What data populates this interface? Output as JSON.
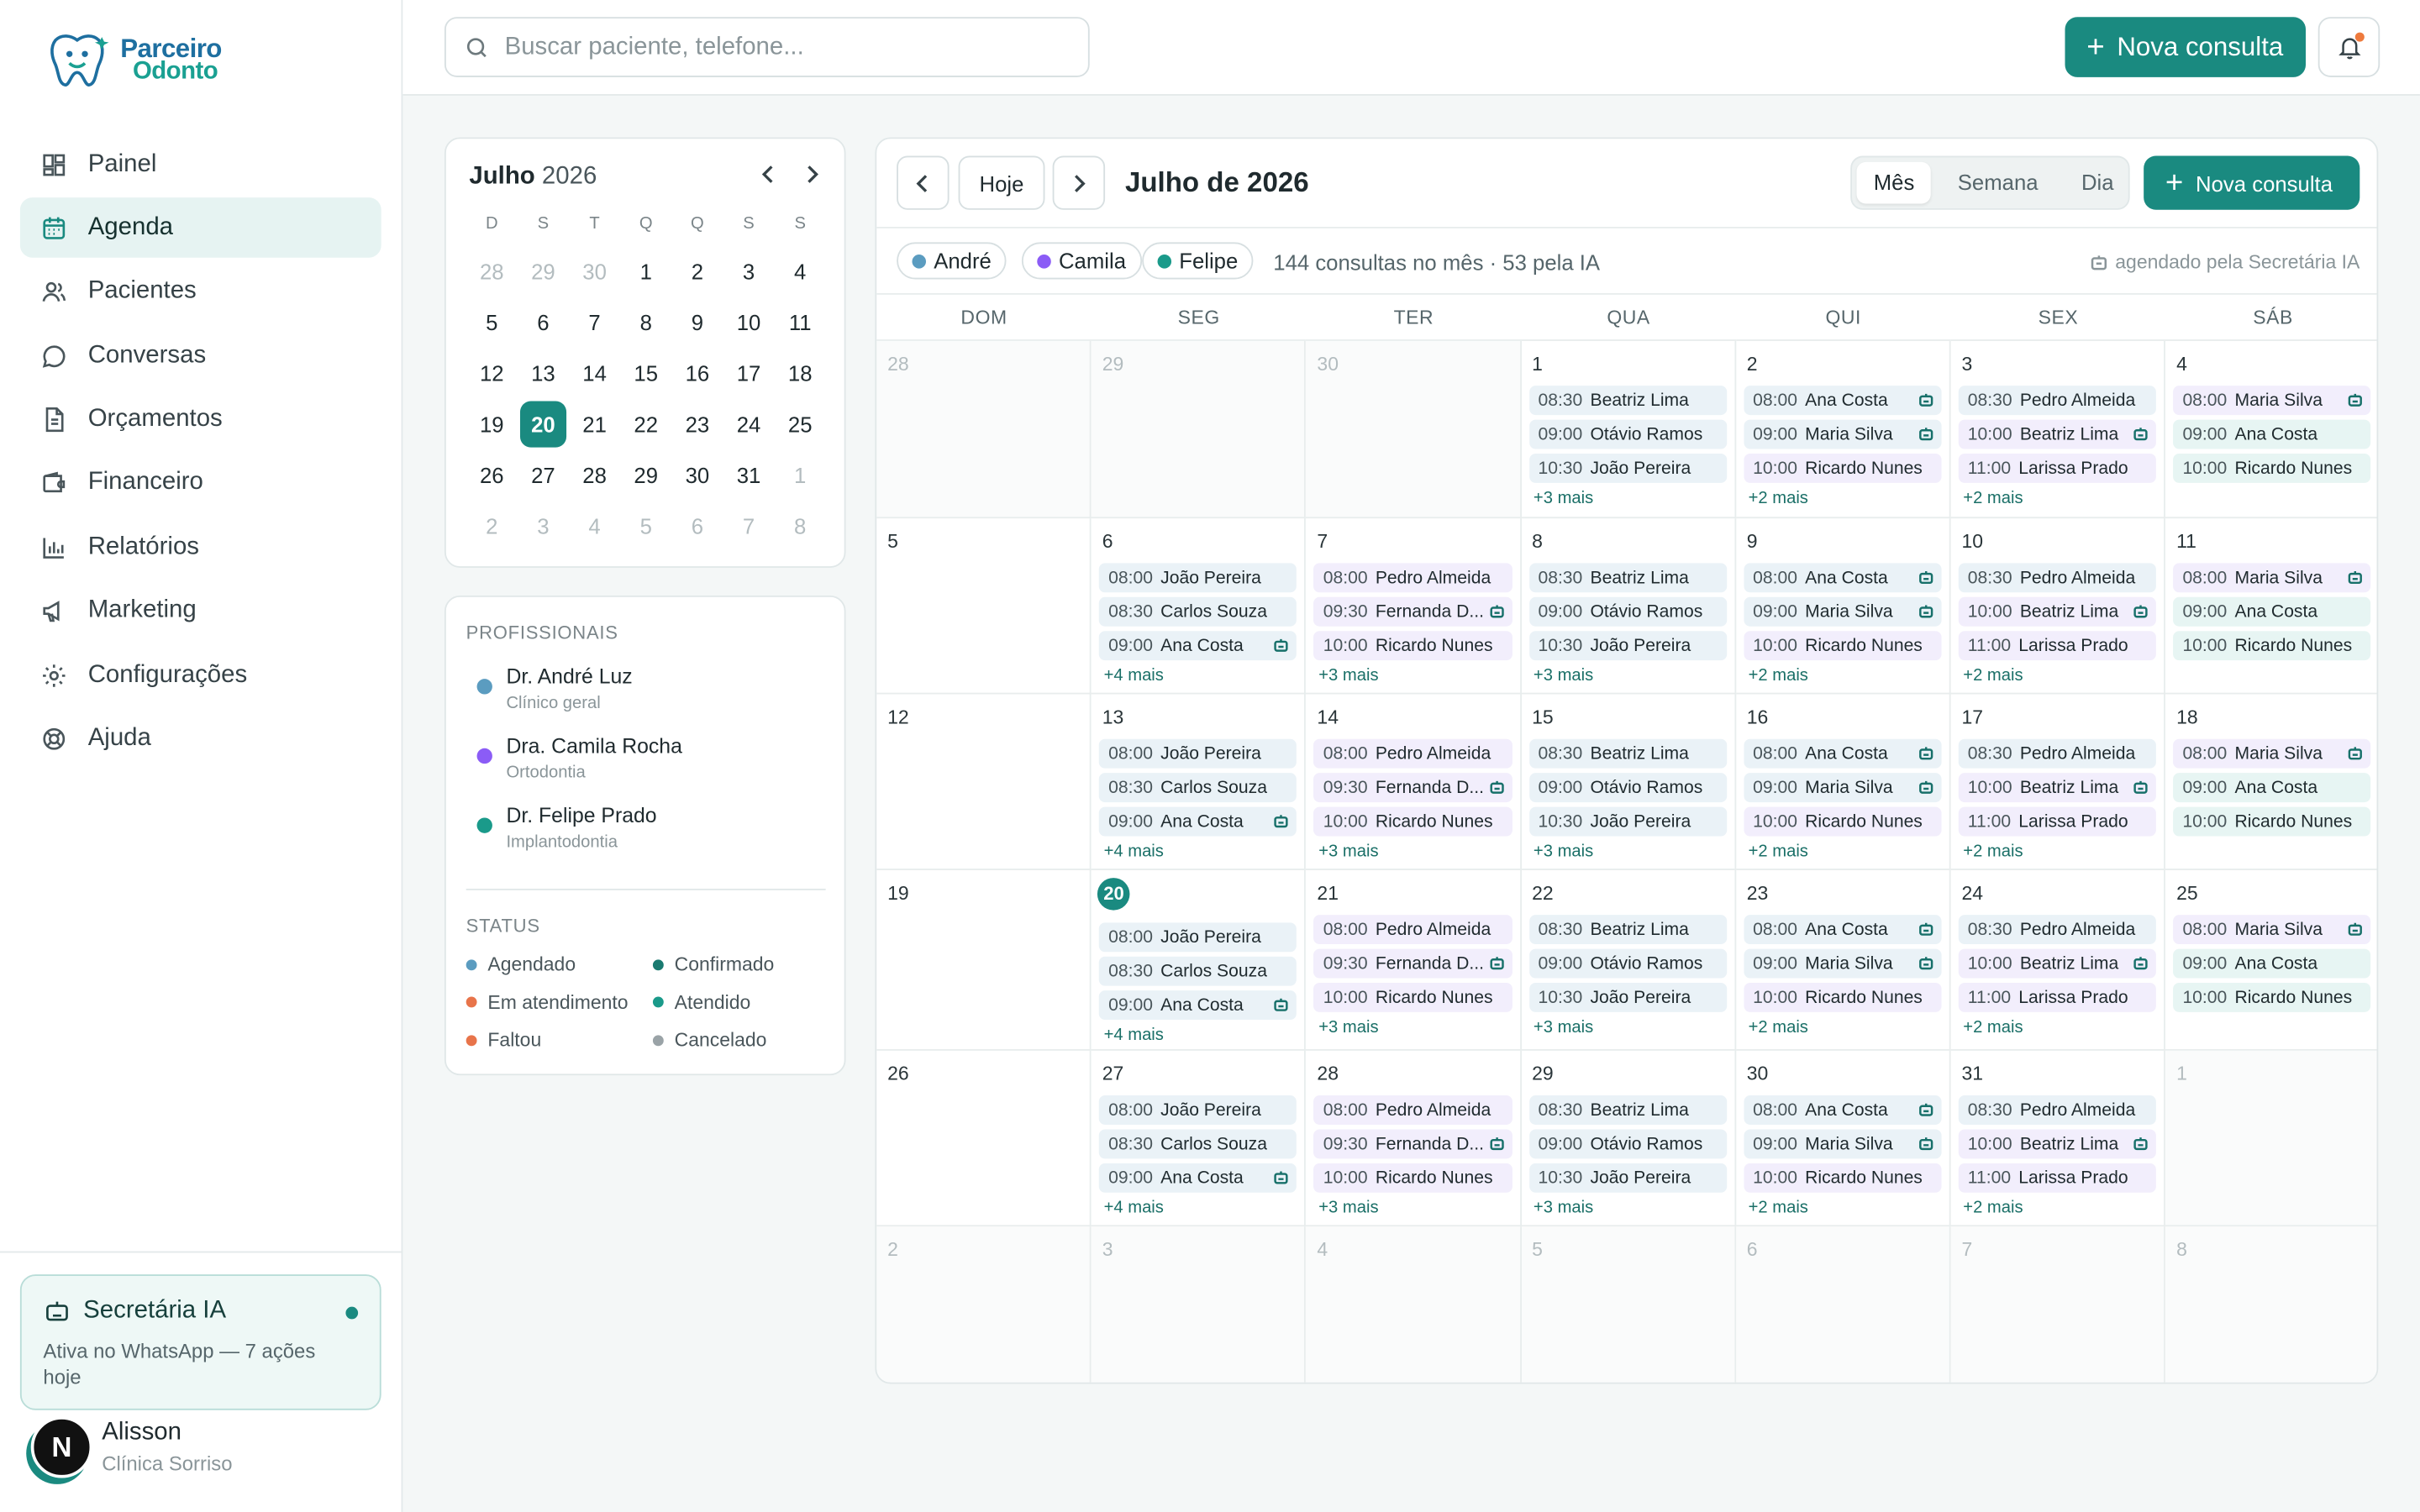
{
  "brand": {
    "line1": "Parceiro",
    "line2": "Odonto"
  },
  "nav": [
    {
      "id": "painel",
      "label": "Painel",
      "icon": "dashboard-icon"
    },
    {
      "id": "agenda",
      "label": "Agenda",
      "icon": "calendar-icon",
      "active": true
    },
    {
      "id": "pacientes",
      "label": "Pacientes",
      "icon": "users-icon"
    },
    {
      "id": "conversas",
      "label": "Conversas",
      "icon": "chat-icon"
    },
    {
      "id": "orcamentos",
      "label": "Orçamentos",
      "icon": "document-icon"
    },
    {
      "id": "financeiro",
      "label": "Financeiro",
      "icon": "wallet-icon"
    },
    {
      "id": "relatorios",
      "label": "Relatórios",
      "icon": "chart-icon"
    },
    {
      "id": "marketing",
      "label": "Marketing",
      "icon": "megaphone-icon"
    },
    {
      "id": "configuracoes",
      "label": "Configurações",
      "icon": "gear-icon"
    },
    {
      "id": "ajuda",
      "label": "Ajuda",
      "icon": "lifebuoy-icon"
    }
  ],
  "ai_card": {
    "title": "Secretária IA",
    "subtitle": "Ativa no WhatsApp — 7 ações hoje"
  },
  "user": {
    "initial": "N",
    "name": "Alisson",
    "org": "Clínica Sorriso"
  },
  "search": {
    "placeholder": "Buscar paciente, telefone..."
  },
  "top_new_label": "Nova consulta",
  "mini_calendar": {
    "month": "Julho",
    "year": "2026",
    "dow": [
      "D",
      "S",
      "T",
      "Q",
      "Q",
      "S",
      "S"
    ],
    "weeks": [
      [
        [
          "28",
          true
        ],
        [
          "29",
          true
        ],
        [
          "30",
          true
        ],
        [
          "1",
          false
        ],
        [
          "2",
          false
        ],
        [
          "3",
          false
        ],
        [
          "4",
          false
        ]
      ],
      [
        [
          "5",
          false
        ],
        [
          "6",
          false
        ],
        [
          "7",
          false
        ],
        [
          "8",
          false
        ],
        [
          "9",
          false
        ],
        [
          "10",
          false
        ],
        [
          "11",
          false
        ]
      ],
      [
        [
          "12",
          false
        ],
        [
          "13",
          false
        ],
        [
          "14",
          false
        ],
        [
          "15",
          false
        ],
        [
          "16",
          false
        ],
        [
          "17",
          false
        ],
        [
          "18",
          false
        ]
      ],
      [
        [
          "19",
          false
        ],
        [
          "20",
          false
        ],
        [
          "21",
          false
        ],
        [
          "22",
          false
        ],
        [
          "23",
          false
        ],
        [
          "24",
          false
        ],
        [
          "25",
          false
        ]
      ],
      [
        [
          "26",
          false
        ],
        [
          "27",
          false
        ],
        [
          "28",
          false
        ],
        [
          "29",
          false
        ],
        [
          "30",
          false
        ],
        [
          "31",
          false
        ],
        [
          "1",
          true
        ]
      ],
      [
        [
          "2",
          true
        ],
        [
          "3",
          true
        ],
        [
          "4",
          true
        ],
        [
          "5",
          true
        ],
        [
          "6",
          true
        ],
        [
          "7",
          true
        ],
        [
          "8",
          true
        ]
      ]
    ],
    "today": "20"
  },
  "professionals": {
    "label": "PROFISSIONAIS",
    "items": [
      {
        "name": "Dr. André Luz",
        "spec": "Clínico geral",
        "color": "#5b9cc0"
      },
      {
        "name": "Dra. Camila Rocha",
        "spec": "Ortodontia",
        "color": "#8b5cf6"
      },
      {
        "name": "Dr. Felipe Prado",
        "spec": "Implantodontia",
        "color": "#1a9a8a"
      }
    ]
  },
  "status": {
    "label": "STATUS",
    "items": [
      {
        "label": "Agendado",
        "color": "#5b9cc0"
      },
      {
        "label": "Confirmado",
        "color": "#1a7a70"
      },
      {
        "label": "Em atendimento",
        "color": "#e8744a"
      },
      {
        "label": "Atendido",
        "color": "#1a9a8a"
      },
      {
        "label": "Faltou",
        "color": "#e8744a"
      },
      {
        "label": "Cancelado",
        "color": "#9aa3a7"
      }
    ]
  },
  "calendar": {
    "today_label": "Hoje",
    "title": "Julho de 2026",
    "views": [
      "Mês",
      "Semana",
      "Dia"
    ],
    "active_view": "Mês",
    "new_label": "Nova consulta",
    "filters": [
      {
        "label": "André",
        "color": "#5b9cc0"
      },
      {
        "label": "Camila",
        "color": "#8b5cf6"
      },
      {
        "label": "Felipe",
        "color": "#1a9a8a"
      }
    ],
    "summary": "144 consultas no mês · 53 pela IA",
    "ai_legend": "agendado pela Secretária IA",
    "dow": [
      "DOM",
      "SEG",
      "TER",
      "QUA",
      "QUI",
      "SEX",
      "SÁB"
    ],
    "weeks": [
      [
        {
          "d": "28",
          "out": true
        },
        {
          "d": "29",
          "out": true
        },
        {
          "d": "30",
          "out": true
        },
        {
          "d": "1",
          "appts": [
            [
              "08:30",
              "Beatriz Lima",
              "a",
              false
            ],
            [
              "09:00",
              "Otávio Ramos",
              "a",
              false
            ],
            [
              "10:30",
              "João Pereira",
              "a",
              false
            ]
          ],
          "more": "+3 mais"
        },
        {
          "d": "2",
          "appts": [
            [
              "08:00",
              "Ana Costa",
              "a",
              true
            ],
            [
              "09:00",
              "Maria Silva",
              "a",
              true
            ],
            [
              "10:00",
              "Ricardo Nunes",
              "b",
              false
            ]
          ],
          "more": "+2 mais"
        },
        {
          "d": "3",
          "appts": [
            [
              "08:30",
              "Pedro Almeida",
              "a",
              false
            ],
            [
              "10:00",
              "Beatriz Lima",
              "b",
              true
            ],
            [
              "11:00",
              "Larissa Prado",
              "b",
              false
            ]
          ],
          "more": "+2 mais"
        },
        {
          "d": "4",
          "appts": [
            [
              "08:00",
              "Maria Silva",
              "b",
              true
            ],
            [
              "09:00",
              "Ana Costa",
              "c",
              false
            ],
            [
              "10:00",
              "Ricardo Nunes",
              "c",
              false
            ]
          ]
        }
      ],
      [
        {
          "d": "5"
        },
        {
          "d": "6",
          "appts": [
            [
              "08:00",
              "João Pereira",
              "a",
              false
            ],
            [
              "08:30",
              "Carlos Souza",
              "a",
              false
            ],
            [
              "09:00",
              "Ana Costa",
              "a",
              true
            ]
          ],
          "more": "+4 mais"
        },
        {
          "d": "7",
          "appts": [
            [
              "08:00",
              "Pedro Almeida",
              "b",
              false
            ],
            [
              "09:30",
              "Fernanda D...",
              "b",
              true
            ],
            [
              "10:00",
              "Ricardo Nunes",
              "b",
              false
            ]
          ],
          "more": "+3 mais"
        },
        {
          "d": "8",
          "appts": [
            [
              "08:30",
              "Beatriz Lima",
              "a",
              false
            ],
            [
              "09:00",
              "Otávio Ramos",
              "a",
              false
            ],
            [
              "10:30",
              "João Pereira",
              "a",
              false
            ]
          ],
          "more": "+3 mais"
        },
        {
          "d": "9",
          "appts": [
            [
              "08:00",
              "Ana Costa",
              "a",
              true
            ],
            [
              "09:00",
              "Maria Silva",
              "a",
              true
            ],
            [
              "10:00",
              "Ricardo Nunes",
              "b",
              false
            ]
          ],
          "more": "+2 mais"
        },
        {
          "d": "10",
          "appts": [
            [
              "08:30",
              "Pedro Almeida",
              "a",
              false
            ],
            [
              "10:00",
              "Beatriz Lima",
              "b",
              true
            ],
            [
              "11:00",
              "Larissa Prado",
              "b",
              false
            ]
          ],
          "more": "+2 mais"
        },
        {
          "d": "11",
          "appts": [
            [
              "08:00",
              "Maria Silva",
              "b",
              true
            ],
            [
              "09:00",
              "Ana Costa",
              "c",
              false
            ],
            [
              "10:00",
              "Ricardo Nunes",
              "c",
              false
            ]
          ]
        }
      ],
      [
        {
          "d": "12"
        },
        {
          "d": "13",
          "appts": [
            [
              "08:00",
              "João Pereira",
              "a",
              false
            ],
            [
              "08:30",
              "Carlos Souza",
              "a",
              false
            ],
            [
              "09:00",
              "Ana Costa",
              "a",
              true
            ]
          ],
          "more": "+4 mais"
        },
        {
          "d": "14",
          "appts": [
            [
              "08:00",
              "Pedro Almeida",
              "b",
              false
            ],
            [
              "09:30",
              "Fernanda D...",
              "b",
              true
            ],
            [
              "10:00",
              "Ricardo Nunes",
              "b",
              false
            ]
          ],
          "more": "+3 mais"
        },
        {
          "d": "15",
          "appts": [
            [
              "08:30",
              "Beatriz Lima",
              "a",
              false
            ],
            [
              "09:00",
              "Otávio Ramos",
              "a",
              false
            ],
            [
              "10:30",
              "João Pereira",
              "a",
              false
            ]
          ],
          "more": "+3 mais"
        },
        {
          "d": "16",
          "appts": [
            [
              "08:00",
              "Ana Costa",
              "a",
              true
            ],
            [
              "09:00",
              "Maria Silva",
              "a",
              true
            ],
            [
              "10:00",
              "Ricardo Nunes",
              "b",
              false
            ]
          ],
          "more": "+2 mais"
        },
        {
          "d": "17",
          "appts": [
            [
              "08:30",
              "Pedro Almeida",
              "a",
              false
            ],
            [
              "10:00",
              "Beatriz Lima",
              "b",
              true
            ],
            [
              "11:00",
              "Larissa Prado",
              "b",
              false
            ]
          ],
          "more": "+2 mais"
        },
        {
          "d": "18",
          "appts": [
            [
              "08:00",
              "Maria Silva",
              "b",
              true
            ],
            [
              "09:00",
              "Ana Costa",
              "c",
              false
            ],
            [
              "10:00",
              "Ricardo Nunes",
              "c",
              false
            ]
          ]
        }
      ],
      [
        {
          "d": "19"
        },
        {
          "d": "20",
          "today": true,
          "appts": [
            [
              "08:00",
              "João Pereira",
              "a",
              false
            ],
            [
              "08:30",
              "Carlos Souza",
              "a",
              false
            ],
            [
              "09:00",
              "Ana Costa",
              "a",
              true
            ]
          ],
          "more": "+4 mais"
        },
        {
          "d": "21",
          "appts": [
            [
              "08:00",
              "Pedro Almeida",
              "b",
              false
            ],
            [
              "09:30",
              "Fernanda D...",
              "b",
              true
            ],
            [
              "10:00",
              "Ricardo Nunes",
              "b",
              false
            ]
          ],
          "more": "+3 mais"
        },
        {
          "d": "22",
          "appts": [
            [
              "08:30",
              "Beatriz Lima",
              "a",
              false
            ],
            [
              "09:00",
              "Otávio Ramos",
              "a",
              false
            ],
            [
              "10:30",
              "João Pereira",
              "a",
              false
            ]
          ],
          "more": "+3 mais"
        },
        {
          "d": "23",
          "appts": [
            [
              "08:00",
              "Ana Costa",
              "a",
              true
            ],
            [
              "09:00",
              "Maria Silva",
              "a",
              true
            ],
            [
              "10:00",
              "Ricardo Nunes",
              "b",
              false
            ]
          ],
          "more": "+2 mais"
        },
        {
          "d": "24",
          "appts": [
            [
              "08:30",
              "Pedro Almeida",
              "a",
              false
            ],
            [
              "10:00",
              "Beatriz Lima",
              "b",
              true
            ],
            [
              "11:00",
              "Larissa Prado",
              "b",
              false
            ]
          ],
          "more": "+2 mais"
        },
        {
          "d": "25",
          "appts": [
            [
              "08:00",
              "Maria Silva",
              "b",
              true
            ],
            [
              "09:00",
              "Ana Costa",
              "c",
              false
            ],
            [
              "10:00",
              "Ricardo Nunes",
              "c",
              false
            ]
          ]
        }
      ],
      [
        {
          "d": "26"
        },
        {
          "d": "27",
          "appts": [
            [
              "08:00",
              "João Pereira",
              "a",
              false
            ],
            [
              "08:30",
              "Carlos Souza",
              "a",
              false
            ],
            [
              "09:00",
              "Ana Costa",
              "a",
              true
            ]
          ],
          "more": "+4 mais"
        },
        {
          "d": "28",
          "appts": [
            [
              "08:00",
              "Pedro Almeida",
              "b",
              false
            ],
            [
              "09:30",
              "Fernanda D...",
              "b",
              true
            ],
            [
              "10:00",
              "Ricardo Nunes",
              "b",
              false
            ]
          ],
          "more": "+3 mais"
        },
        {
          "d": "29",
          "appts": [
            [
              "08:30",
              "Beatriz Lima",
              "a",
              false
            ],
            [
              "09:00",
              "Otávio Ramos",
              "a",
              false
            ],
            [
              "10:30",
              "João Pereira",
              "a",
              false
            ]
          ],
          "more": "+3 mais"
        },
        {
          "d": "30",
          "appts": [
            [
              "08:00",
              "Ana Costa",
              "a",
              true
            ],
            [
              "09:00",
              "Maria Silva",
              "a",
              true
            ],
            [
              "10:00",
              "Ricardo Nunes",
              "b",
              false
            ]
          ],
          "more": "+2 mais"
        },
        {
          "d": "31",
          "appts": [
            [
              "08:30",
              "Pedro Almeida",
              "a",
              false
            ],
            [
              "10:00",
              "Beatriz Lima",
              "b",
              true
            ],
            [
              "11:00",
              "Larissa Prado",
              "b",
              false
            ]
          ],
          "more": "+2 mais"
        },
        {
          "d": "1",
          "out": true
        }
      ],
      [
        {
          "d": "2",
          "out": true
        },
        {
          "d": "3",
          "out": true
        },
        {
          "d": "4",
          "out": true
        },
        {
          "d": "5",
          "out": true
        },
        {
          "d": "6",
          "out": true
        },
        {
          "d": "7",
          "out": true
        },
        {
          "d": "8",
          "out": true
        }
      ]
    ]
  }
}
